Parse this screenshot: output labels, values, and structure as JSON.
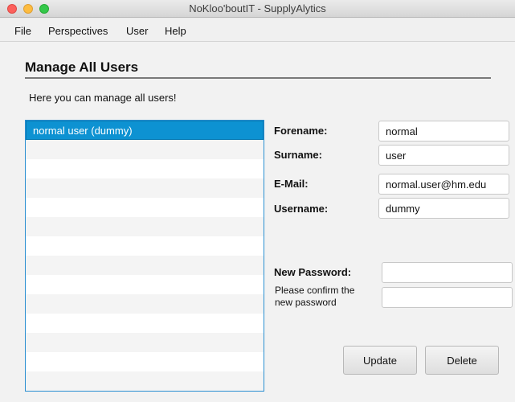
{
  "window": {
    "title": "NoKloo'boutIT - SupplyAlytics"
  },
  "menu": [
    "File",
    "Perspectives",
    "User",
    "Help"
  ],
  "page": {
    "title": "Manage All Users",
    "subtitle": "Here you can manage all users!"
  },
  "users": {
    "items": [
      "normal user (dummy)"
    ],
    "selected_index": 0
  },
  "form": {
    "forename_label": "Forename:",
    "forename_value": "normal",
    "surname_label": "Surname:",
    "surname_value": "user",
    "email_label": "E-Mail:",
    "email_value": "normal.user@hm.edu",
    "username_label": "Username:",
    "username_value": "dummy",
    "new_password_label": "New Password:",
    "new_password_value": "",
    "confirm_label_line1": "Please confirm the",
    "confirm_label_line2": "new password",
    "confirm_value": ""
  },
  "buttons": {
    "update": "Update",
    "delete": "Delete"
  },
  "colors": {
    "selection": "#0d92d2",
    "list_border": "#2a8fd1"
  }
}
